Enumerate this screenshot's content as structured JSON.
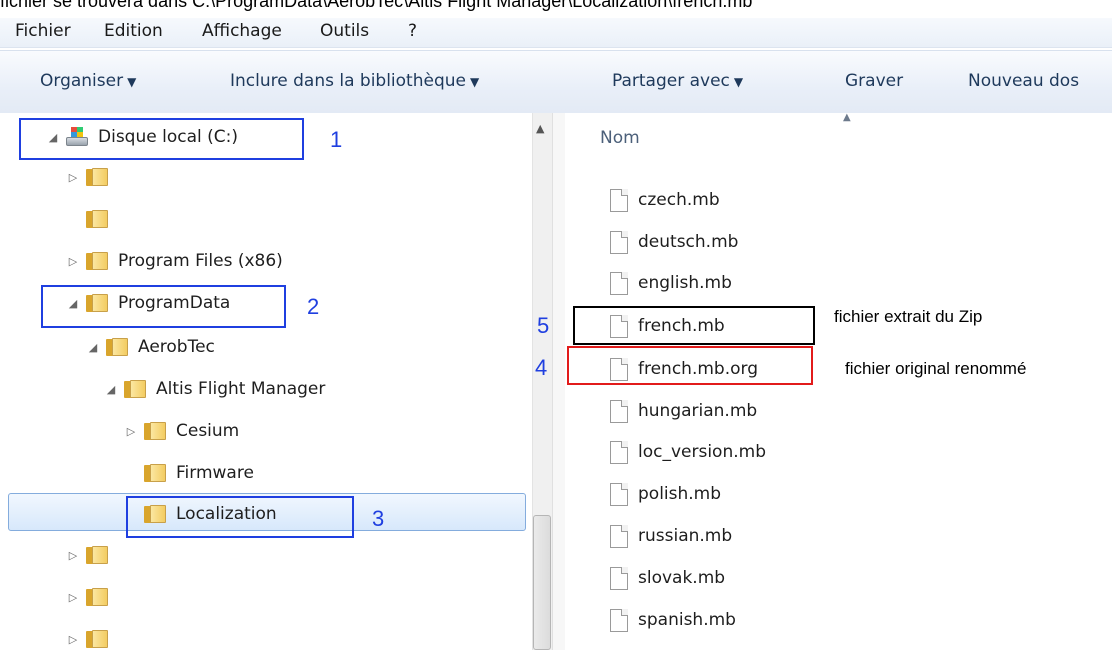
{
  "caption": "fichier se trouvera dans C:\\ProgramData\\AerobTec\\Altis Flight Manager\\Localization\\french.mb",
  "menu": [
    "Fichier",
    "Edition",
    "Affichage",
    "Outils",
    "?"
  ],
  "toolbar": {
    "organize": "Organiser",
    "include": "Inclure dans la bibliothèque",
    "share": "Partager avec",
    "burn": "Graver",
    "new_folder": "Nouveau dos"
  },
  "tree": {
    "drive": "Disque local (C:)",
    "program_files": "Program Files (x86)",
    "program_data": "ProgramData",
    "aerobtec": "AerobTec",
    "altis": "Altis Flight Manager",
    "cesium": "Cesium",
    "firmware": "Firmware",
    "localization": "Localization"
  },
  "files": {
    "column_header": "Nom",
    "items": [
      "czech.mb",
      "deutsch.mb",
      "english.mb",
      "french.mb",
      "french.mb.org",
      "hungarian.mb",
      "loc_version.mb",
      "polish.mb",
      "russian.mb",
      "slovak.mb",
      "spanish.mb"
    ]
  },
  "annotations": {
    "n1": "1",
    "n2": "2",
    "n3": "3",
    "n4": "4",
    "n5": "5",
    "note_extracted": "fichier extrait du Zip",
    "note_renamed": "fichier  original renommé"
  },
  "colors": {
    "annotation_blue": "#1f3fe0",
    "annotation_red": "#e21b1b",
    "annotation_black": "#000000",
    "selection": "#d7e8fb"
  }
}
